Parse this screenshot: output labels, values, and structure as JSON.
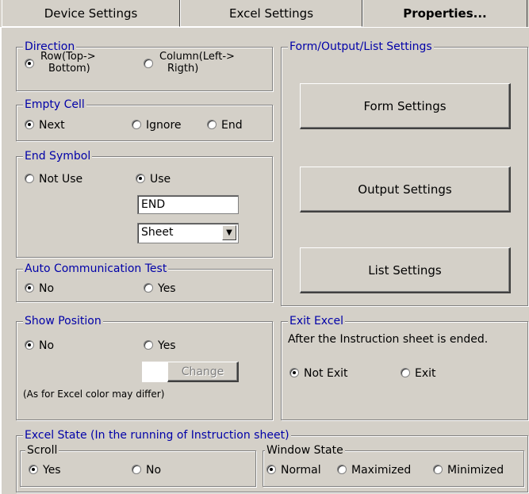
{
  "tabs": [
    {
      "label": "Device Settings"
    },
    {
      "label": "Excel Settings"
    },
    {
      "label": "Properties..."
    }
  ],
  "direction": {
    "title": "Direction",
    "row_label": "Row(Top->\nBottom)",
    "col_label": "Column(Left->\nRigth)",
    "row_line1": "Row(Top->",
    "row_line2": "Bottom)",
    "col_line1": "Column(Left->",
    "col_line2": "Rigth)"
  },
  "empty_cell": {
    "title": "Empty Cell",
    "next": "Next",
    "ignore": "Ignore",
    "end": "End"
  },
  "end_symbol": {
    "title": "End Symbol",
    "not_use": "Not Use",
    "use": "Use",
    "value": "END",
    "sheet_selected": "Sheet"
  },
  "auto_comm": {
    "title": "Auto Communication Test",
    "no": "No",
    "yes": "Yes"
  },
  "show_position": {
    "title": "Show Position",
    "no": "No",
    "yes": "Yes",
    "change": "Change",
    "note": "(As for Excel color may differ)"
  },
  "form_output": {
    "title": "Form/Output/List Settings",
    "form_btn": "Form Settings",
    "output_btn": "Output Settings",
    "list_btn": "List Settings"
  },
  "exit_excel": {
    "title": "Exit Excel",
    "desc": "After the Instruction sheet is ended.",
    "not_exit": "Not Exit",
    "exit": "Exit"
  },
  "excel_state": {
    "title": "Excel State (In the running of Instruction sheet)"
  },
  "scroll": {
    "title": "Scroll",
    "yes": "Yes",
    "no": "No"
  },
  "window_state": {
    "title": "Window State",
    "normal": "Normal",
    "maximized": "Maximized",
    "minimized": "Minimized"
  }
}
